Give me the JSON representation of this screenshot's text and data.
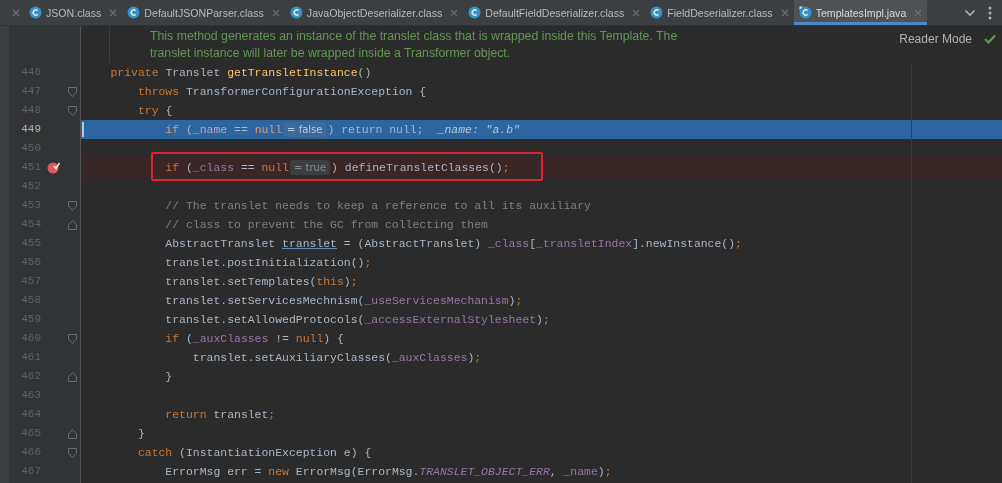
{
  "tabs": [
    {
      "label": "JSON.class",
      "kind": "class",
      "selected": false
    },
    {
      "label": "DefaultJSONParser.class",
      "kind": "class",
      "selected": false
    },
    {
      "label": "JavaObjectDeserializer.class",
      "kind": "class",
      "selected": false
    },
    {
      "label": "DefaultFieldDeserializer.class",
      "kind": "class",
      "selected": false
    },
    {
      "label": "FieldDeserializer.class",
      "kind": "class",
      "selected": false
    },
    {
      "label": "TemplatesImpl.java",
      "kind": "java",
      "selected": true
    }
  ],
  "doc_comment": [
    "This method generates an instance of the translet class that is wrapped inside this Template. The",
    "translet instance will later be wrapped inside a Transformer object."
  ],
  "reader_mode": {
    "label": "Reader Mode",
    "inspections_ok": true
  },
  "lines": [
    {
      "number": "446",
      "current": false,
      "breakpoint": false,
      "boxed": false,
      "parts": [
        {
          "kind": "code",
          "tokens": [
            {
              "kind": "keyword",
              "text": "    private "
            },
            {
              "kind": "plain",
              "text": "Translet "
            },
            {
              "kind": "method",
              "text": "getTransletInstance"
            },
            {
              "kind": "plain",
              "text": "()"
            }
          ]
        }
      ]
    },
    {
      "number": "447",
      "current": false,
      "breakpoint": false,
      "boxed": false,
      "fold_start": true,
      "parts": [
        {
          "kind": "code",
          "tokens": [
            {
              "kind": "keyword",
              "text": "        throws "
            },
            {
              "kind": "plain",
              "text": "TransformerConfigurationException {"
            }
          ]
        }
      ]
    },
    {
      "number": "448",
      "current": false,
      "breakpoint": false,
      "boxed": false,
      "fold_start": true,
      "parts": [
        {
          "kind": "code",
          "tokens": [
            {
              "kind": "keyword",
              "text": "        try "
            },
            {
              "kind": "plain",
              "text": "{"
            }
          ]
        }
      ]
    },
    {
      "number": "449",
      "current": true,
      "breakpoint": false,
      "boxed": false,
      "parts": [
        {
          "kind": "code",
          "tokens": [
            {
              "kind": "keyword",
              "text": "            if "
            },
            {
              "kind": "plain",
              "text": "("
            },
            {
              "kind": "field",
              "text": "_name"
            },
            {
              "kind": "plain",
              "text": " == "
            },
            {
              "kind": "keyword",
              "text": "null"
            }
          ]
        },
        {
          "kind": "hint",
          "text": "= false"
        },
        {
          "kind": "code",
          "tokens": [
            {
              "kind": "plain",
              "text": ") "
            },
            {
              "kind": "dim",
              "text": "return null;"
            }
          ]
        },
        {
          "kind": "value",
          "text": "_name: \"a.b\""
        }
      ]
    },
    {
      "number": "450",
      "current": false,
      "breakpoint": false,
      "boxed": false
    },
    {
      "number": "451",
      "current": false,
      "breakpoint": true,
      "boxed": true,
      "parts": [
        {
          "kind": "code",
          "tokens": [
            {
              "kind": "keyword",
              "text": "            if "
            },
            {
              "kind": "plain",
              "text": "("
            },
            {
              "kind": "field",
              "text": "_class"
            },
            {
              "kind": "plain",
              "text": " == "
            },
            {
              "kind": "keyword",
              "text": "null"
            }
          ]
        },
        {
          "kind": "hint",
          "text": "= true"
        },
        {
          "kind": "code",
          "tokens": [
            {
              "kind": "plain",
              "text": ") defineTransletClasses()"
            },
            {
              "kind": "keyword",
              "text": ";"
            }
          ]
        }
      ]
    },
    {
      "number": "452",
      "current": false,
      "breakpoint": false,
      "boxed": false
    },
    {
      "number": "453",
      "current": false,
      "breakpoint": false,
      "boxed": false,
      "fold_start": true,
      "parts": [
        {
          "kind": "code",
          "tokens": [
            {
              "kind": "comment",
              "text": "            // The translet needs to keep a reference to all its auxiliary"
            }
          ]
        }
      ]
    },
    {
      "number": "454",
      "current": false,
      "breakpoint": false,
      "boxed": false,
      "fold_end": true,
      "parts": [
        {
          "kind": "code",
          "tokens": [
            {
              "kind": "comment",
              "text": "            // class to prevent the GC from collecting them"
            }
          ]
        }
      ]
    },
    {
      "number": "455",
      "current": false,
      "breakpoint": false,
      "boxed": false,
      "parts": [
        {
          "kind": "code",
          "tokens": [
            {
              "kind": "plain",
              "text": "            AbstractTranslet "
            },
            {
              "kind": "decl",
              "text": "translet"
            },
            {
              "kind": "plain",
              "text": " = (AbstractTranslet) "
            },
            {
              "kind": "field",
              "text": "_class"
            },
            {
              "kind": "plain",
              "text": "["
            },
            {
              "kind": "field",
              "text": "_transletIndex"
            },
            {
              "kind": "plain",
              "text": "].newInstance()"
            },
            {
              "kind": "keyword",
              "text": ";"
            }
          ]
        }
      ]
    },
    {
      "number": "456",
      "current": false,
      "breakpoint": false,
      "boxed": false,
      "parts": [
        {
          "kind": "code",
          "tokens": [
            {
              "kind": "plain",
              "text": "            translet.postInitialization()"
            },
            {
              "kind": "keyword",
              "text": ";"
            }
          ]
        }
      ]
    },
    {
      "number": "457",
      "current": false,
      "breakpoint": false,
      "boxed": false,
      "parts": [
        {
          "kind": "code",
          "tokens": [
            {
              "kind": "plain",
              "text": "            translet.setTemplates("
            },
            {
              "kind": "keyword",
              "text": "this"
            },
            {
              "kind": "plain",
              "text": ")"
            },
            {
              "kind": "keyword",
              "text": ";"
            }
          ]
        }
      ]
    },
    {
      "number": "458",
      "current": false,
      "breakpoint": false,
      "boxed": false,
      "parts": [
        {
          "kind": "code",
          "tokens": [
            {
              "kind": "plain",
              "text": "            translet.setServicesMechnism("
            },
            {
              "kind": "field",
              "text": "_useServicesMechanism"
            },
            {
              "kind": "plain",
              "text": ")"
            },
            {
              "kind": "keyword",
              "text": ";"
            }
          ]
        }
      ]
    },
    {
      "number": "459",
      "current": false,
      "breakpoint": false,
      "boxed": false,
      "parts": [
        {
          "kind": "code",
          "tokens": [
            {
              "kind": "plain",
              "text": "            translet.setAllowedProtocols("
            },
            {
              "kind": "field",
              "text": "_accessExternalStylesheet"
            },
            {
              "kind": "plain",
              "text": ")"
            },
            {
              "kind": "keyword",
              "text": ";"
            }
          ]
        }
      ]
    },
    {
      "number": "460",
      "current": false,
      "breakpoint": false,
      "boxed": false,
      "fold_start": true,
      "parts": [
        {
          "kind": "code",
          "tokens": [
            {
              "kind": "keyword",
              "text": "            if "
            },
            {
              "kind": "plain",
              "text": "("
            },
            {
              "kind": "field",
              "text": "_auxClasses"
            },
            {
              "kind": "plain",
              "text": " != "
            },
            {
              "kind": "keyword",
              "text": "null"
            },
            {
              "kind": "plain",
              "text": ") {"
            }
          ]
        }
      ]
    },
    {
      "number": "461",
      "current": false,
      "breakpoint": false,
      "boxed": false,
      "parts": [
        {
          "kind": "code",
          "tokens": [
            {
              "kind": "plain",
              "text": "                translet.setAuxiliaryClasses("
            },
            {
              "kind": "field",
              "text": "_auxClasses"
            },
            {
              "kind": "plain",
              "text": ")"
            },
            {
              "kind": "keyword",
              "text": ";"
            }
          ]
        }
      ]
    },
    {
      "number": "462",
      "current": false,
      "breakpoint": false,
      "boxed": false,
      "fold_end": true,
      "parts": [
        {
          "kind": "code",
          "tokens": [
            {
              "kind": "plain",
              "text": "            }"
            }
          ]
        }
      ]
    },
    {
      "number": "463",
      "current": false,
      "breakpoint": false,
      "boxed": false
    },
    {
      "number": "464",
      "current": false,
      "breakpoint": false,
      "boxed": false,
      "parts": [
        {
          "kind": "code",
          "tokens": [
            {
              "kind": "keyword",
              "text": "            return "
            },
            {
              "kind": "plain",
              "text": "translet"
            },
            {
              "kind": "keyword",
              "text": ";"
            }
          ]
        }
      ]
    },
    {
      "number": "465",
      "current": false,
      "breakpoint": false,
      "boxed": false,
      "fold_end": true,
      "parts": [
        {
          "kind": "code",
          "tokens": [
            {
              "kind": "plain",
              "text": "        }"
            }
          ]
        }
      ]
    },
    {
      "number": "466",
      "current": false,
      "breakpoint": false,
      "boxed": false,
      "fold_start": true,
      "parts": [
        {
          "kind": "code",
          "tokens": [
            {
              "kind": "keyword",
              "text": "        catch "
            },
            {
              "kind": "plain",
              "text": "(InstantiationException e) {"
            }
          ]
        }
      ]
    },
    {
      "number": "467",
      "current": false,
      "breakpoint": false,
      "boxed": false,
      "parts": [
        {
          "kind": "code",
          "tokens": [
            {
              "kind": "plain",
              "text": "            ErrorMsg err = "
            },
            {
              "kind": "keyword",
              "text": "new "
            },
            {
              "kind": "plain",
              "text": "ErrorMsg(ErrorMsg."
            },
            {
              "kind": "constant",
              "text": "TRANSLET_OBJECT_ERR"
            },
            {
              "kind": "plain",
              "text": ", "
            },
            {
              "kind": "field",
              "text": "_name"
            },
            {
              "kind": "plain",
              "text": ")"
            },
            {
              "kind": "keyword",
              "text": ";"
            }
          ]
        }
      ]
    }
  ]
}
